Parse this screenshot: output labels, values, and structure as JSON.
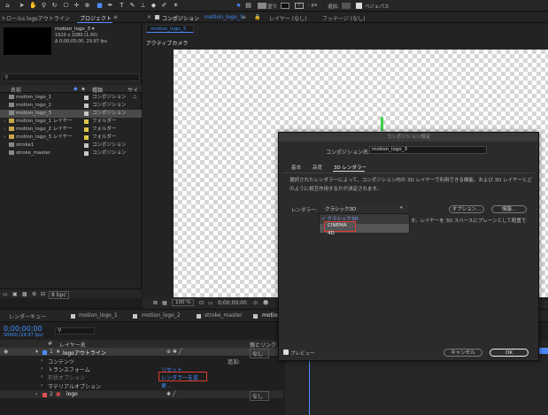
{
  "toolbar": {
    "tools": [
      "home-icon",
      "selection-arrow-icon",
      "hand-icon",
      "zoom-icon",
      "rotate-icon",
      "camera-icon",
      "pan-behind-icon",
      "rectangle-icon",
      "pen-icon",
      "type-icon",
      "brush-icon",
      "clone-stamp-icon",
      "eraser-icon",
      "roto-brush-icon",
      "puppet-icon"
    ],
    "fill_label": "塗り",
    "stroke_px": "- px",
    "add_label": "追加:",
    "bezier_label": "ベジェパス"
  },
  "project_panel": {
    "tab_left": "トロールs logoアウトライン",
    "tab_project": "プロジェクト",
    "comp_name": "motion_logo_3 ▾",
    "comp_size": "1920 x 1080 (1.00)",
    "comp_dur": "Δ 0;00;05;00, 29.97 fps",
    "col_name": "名前",
    "col_type": "種類",
    "col_size": "サイ",
    "items": [
      {
        "name": "motion_logo_1",
        "type": "コンポジション",
        "kind": "comp",
        "chip": "#c6c6c6"
      },
      {
        "name": "motion_logo_2",
        "type": "コンポジション",
        "kind": "comp",
        "chip": "#c6c6c6"
      },
      {
        "name": "motion_logo_3",
        "type": "コンポジション",
        "kind": "comp",
        "chip": "#c6c6c6",
        "selected": true
      },
      {
        "name": "motion_logo_1 レイヤー",
        "type": "フォルダー",
        "kind": "folder",
        "chip": "#e2c54a"
      },
      {
        "name": "motion_logo_2 レイヤー",
        "type": "フォルダー",
        "kind": "folder",
        "chip": "#e2c54a"
      },
      {
        "name": "motion_logo_3 レイヤー",
        "type": "フォルダー",
        "kind": "folder",
        "chip": "#e2c54a"
      },
      {
        "name": "stroke1",
        "type": "コンポジション",
        "kind": "comp",
        "chip": "#c6c6c6"
      },
      {
        "name": "stroke_master",
        "type": "コンポジション",
        "kind": "comp",
        "chip": "#c6c6c6"
      }
    ],
    "bpc": "8 bpc"
  },
  "comp_panel": {
    "tab_label": "コンポジション",
    "tab_comp": "motion_logo_3",
    "tab_layer": "レイヤー (なし)",
    "tab_footage": "フッテージ (なし)",
    "sub_tab": "motion_logo_3",
    "active_camera": "アクティブカメラ",
    "zoom": "100 %",
    "timecode": "0;00;00;00"
  },
  "timeline": {
    "tabs": [
      "レンダーキュー",
      "motion_logo_1",
      "motion_logo_2",
      "stroke_master",
      "motion_logo_3"
    ],
    "timecode": "0;00;00;00",
    "frames": "00000 (29.97 fps)",
    "col_num": "#",
    "col_layer": "レイヤー名",
    "col_parent": "親とリンク",
    "layer1_num": "1",
    "layer1_name": "logoアウトライン",
    "layer1_parent": "なし",
    "contents": "コンテンツ",
    "add": "追加:",
    "transform": "トランスフォーム",
    "reset": "リセット",
    "geometry": "形状オプション",
    "renderer_change": "レンダラーを変更...",
    "material": "マテリアルオプション",
    "layer2_num": "2",
    "layer2_name": "logo",
    "layer2_parent": "なし"
  },
  "dialog": {
    "title": "コンポジション設定",
    "name_label": "コンポジション名:",
    "name_value": "motion_logo_3",
    "tabs": [
      "基本",
      "高度",
      "3D レンダラー"
    ],
    "description": "選択されたレンダラーによって、コンポジション内の 3D レイヤーで利用できる機能、および 3D レイヤーとどのように相互作用するかが決定されます。",
    "renderer_label": "レンダラー:",
    "renderer_value": "クラシック3D",
    "options_button": "オプション...",
    "info_button": "情報...",
    "dropdown_options": [
      "クラシック3D",
      "CINEMA 4D"
    ],
    "side_text": "す。レイヤーを 3D スペースにプレーンとして配置で",
    "preview_label": "プレビュー",
    "cancel": "キャンセル",
    "ok": "OK"
  }
}
